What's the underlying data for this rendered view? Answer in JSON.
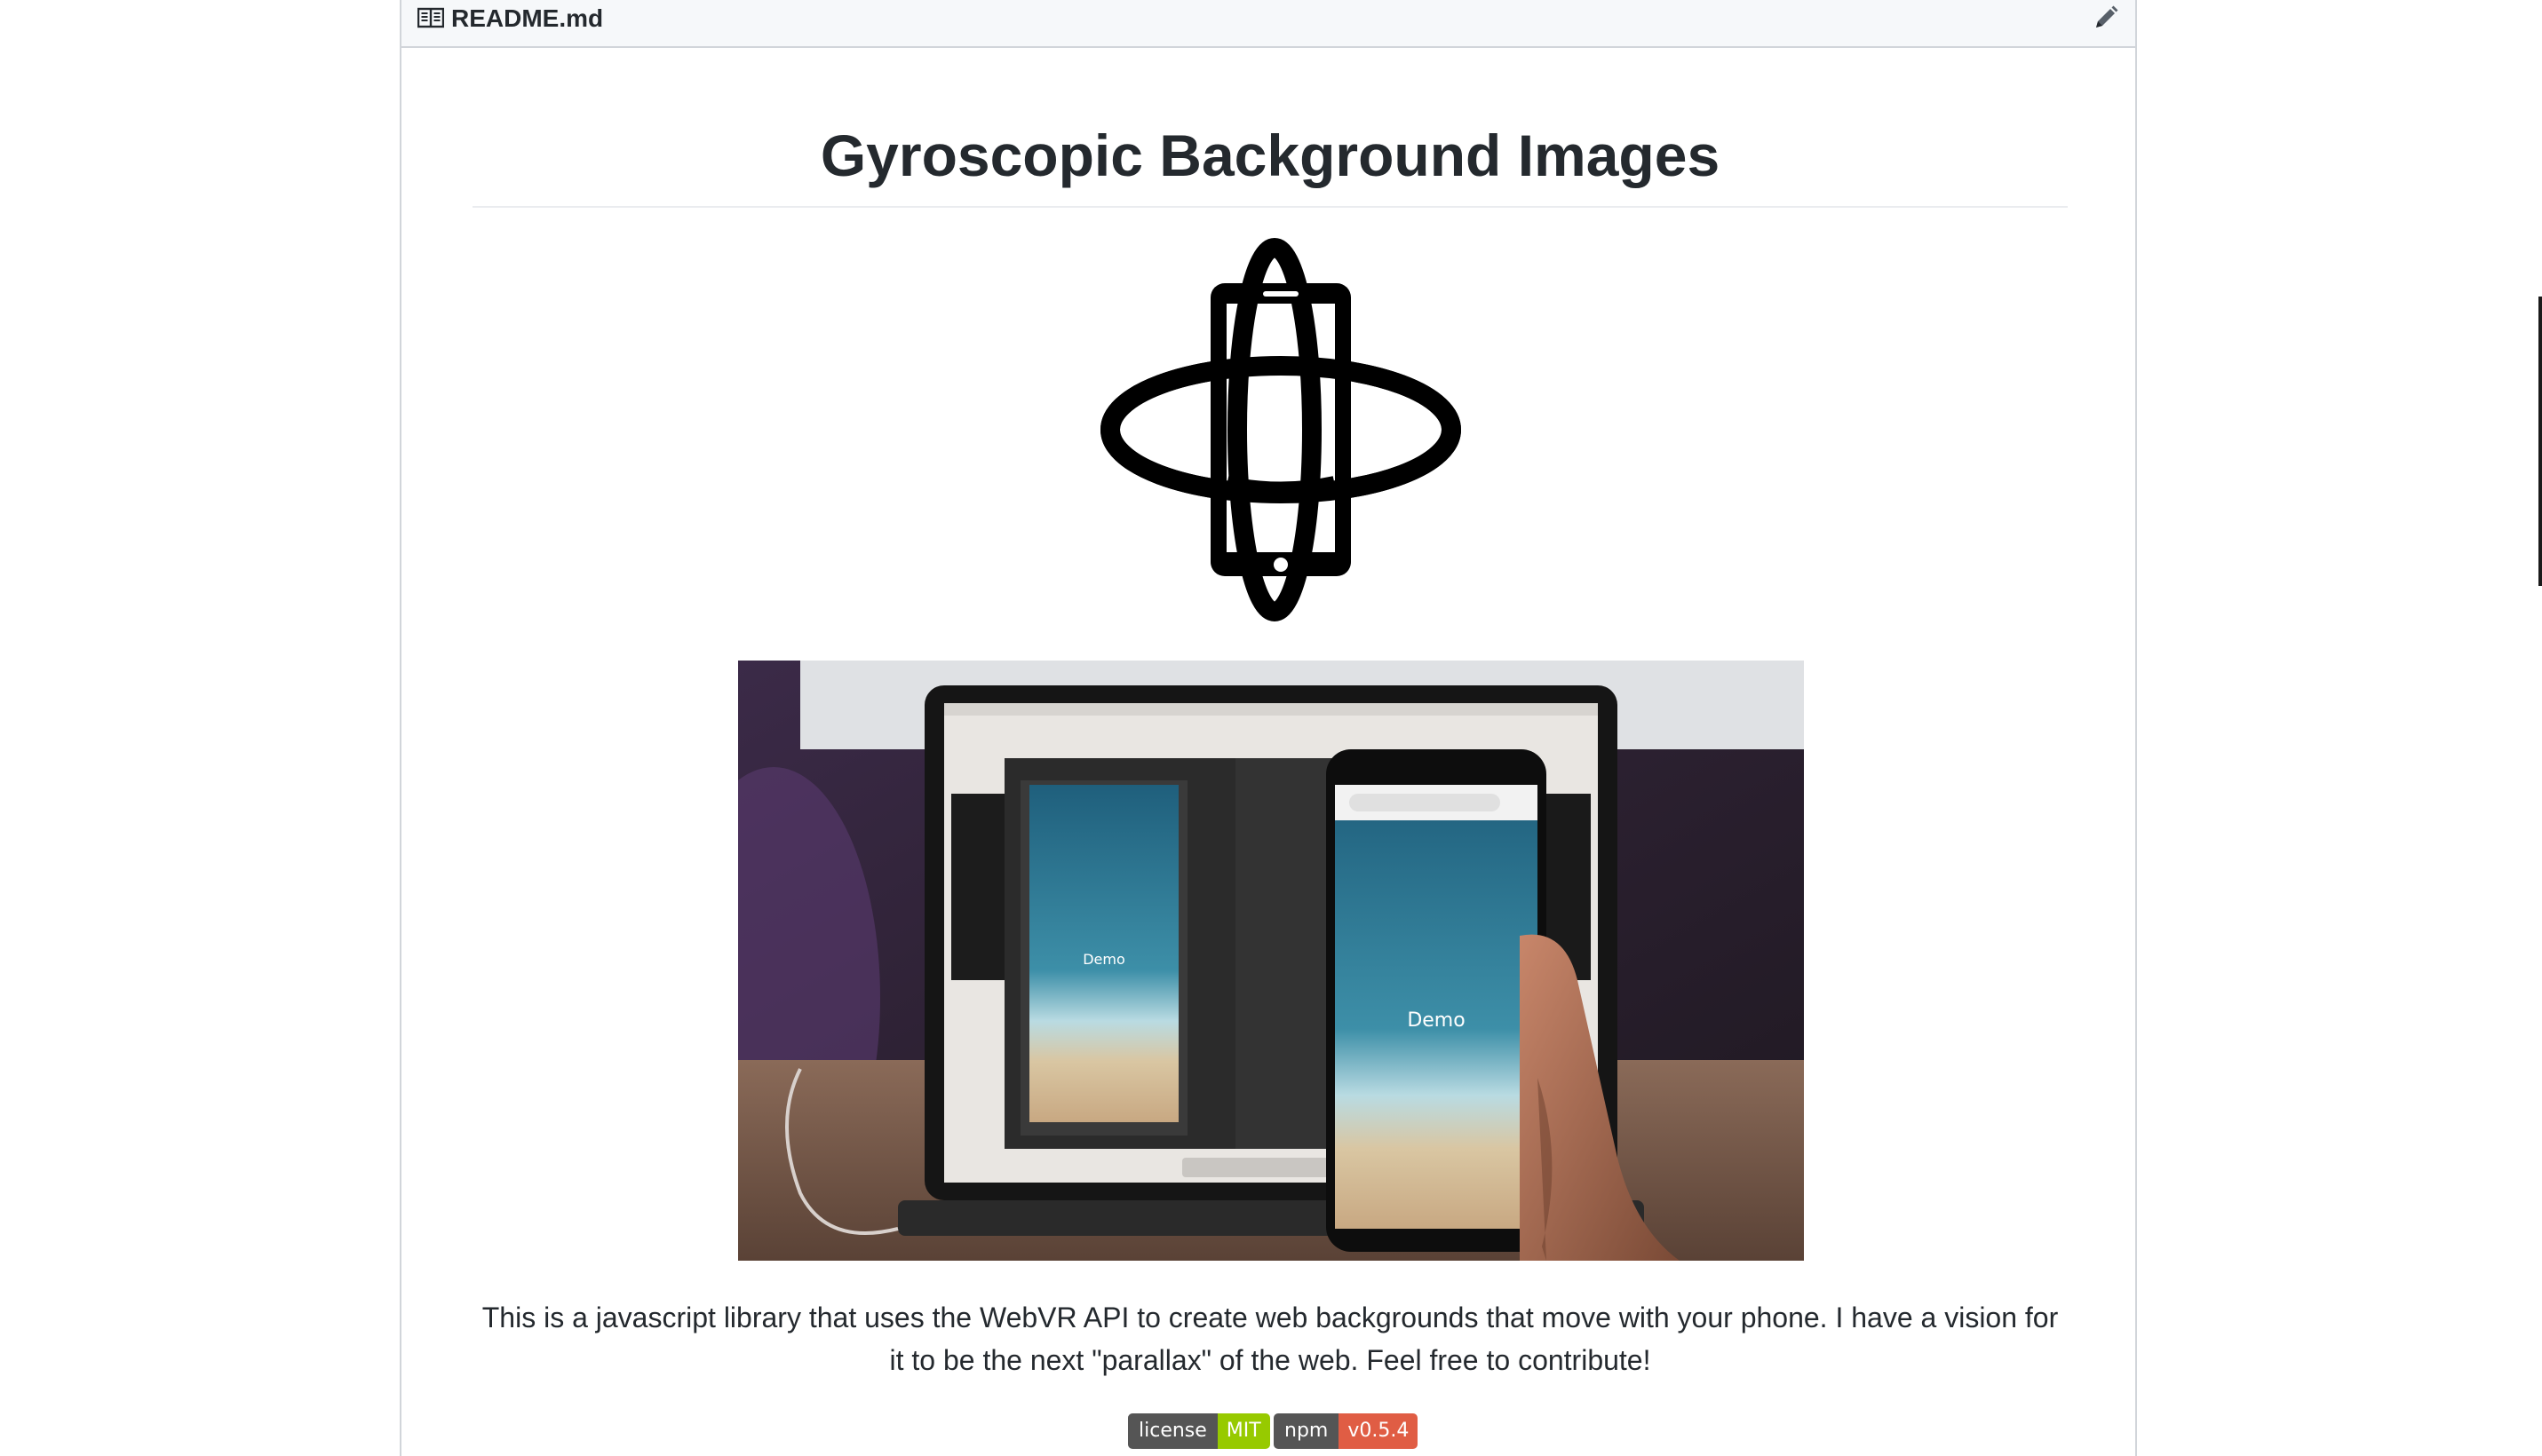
{
  "file": {
    "name": "README.md",
    "file_icon": "book-open-icon",
    "edit_icon": "pencil-icon"
  },
  "readme": {
    "title": "Gyroscopic Background Images",
    "logo_icon": "gyroscope-phone-icon",
    "description": "This is a javascript library that uses the WebVR API to create web backgrounds that move with your phone. I have a vision for it to be the next \"parallax\" of the web. Feel free to contribute!"
  },
  "demo": {
    "laptop_label": "Demo",
    "phone_label": "Demo"
  },
  "badges": [
    {
      "label": "license",
      "value": "MIT",
      "color": "#97ca00"
    },
    {
      "label": "npm",
      "value": "v0.5.4",
      "color": "#e05d44"
    }
  ],
  "colors": {
    "header_bg": "#f6f8fa",
    "border": "#d1d5da",
    "text": "#24292e",
    "badge_label_bg": "#555555"
  }
}
